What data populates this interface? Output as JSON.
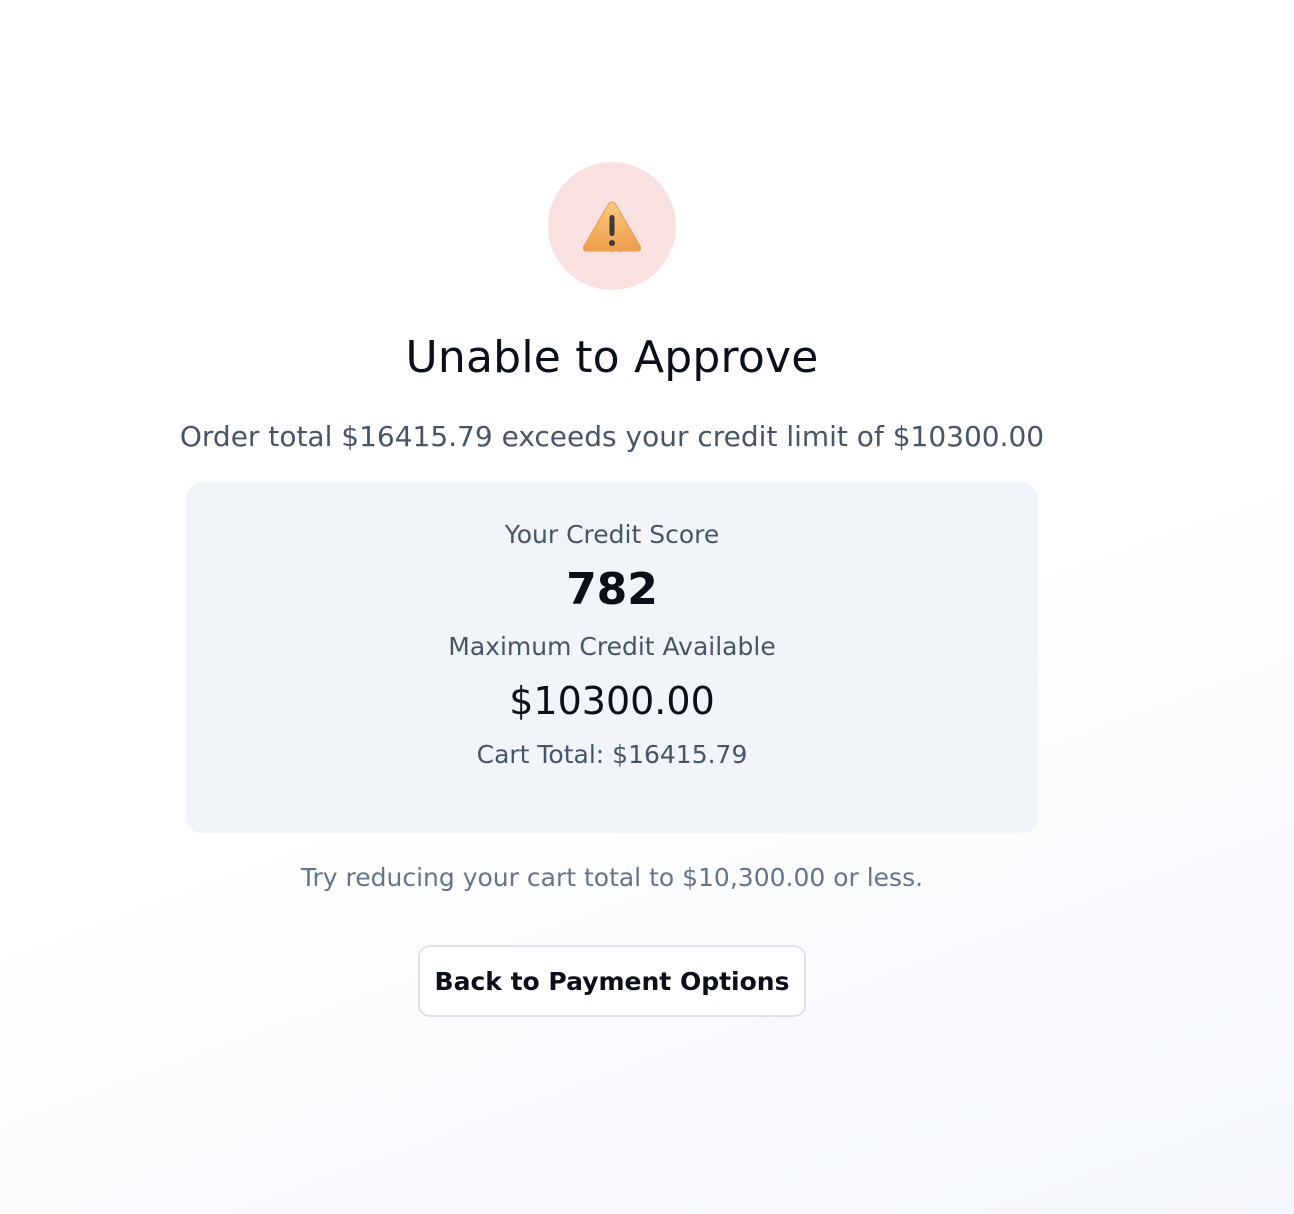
{
  "icon": {
    "name": "warning-icon"
  },
  "title": "Unable to Approve",
  "message": "Order total $16415.79 exceeds your credit limit of $10300.00",
  "card": {
    "score_label": "Your Credit Score",
    "score": "782",
    "credit_label": "Maximum Credit Available",
    "credit_amount": "$10300.00",
    "cart_total": "Cart Total: $16415.79"
  },
  "hint": "Try reducing your cart total to $10,300.00 or less.",
  "actions": {
    "back_label": "Back to Payment Options"
  },
  "colors": {
    "icon_background": "#f9e1e1",
    "warning_fill": "#f4b35e",
    "card_background": "#f1f4f8",
    "muted_text": "#475569"
  }
}
